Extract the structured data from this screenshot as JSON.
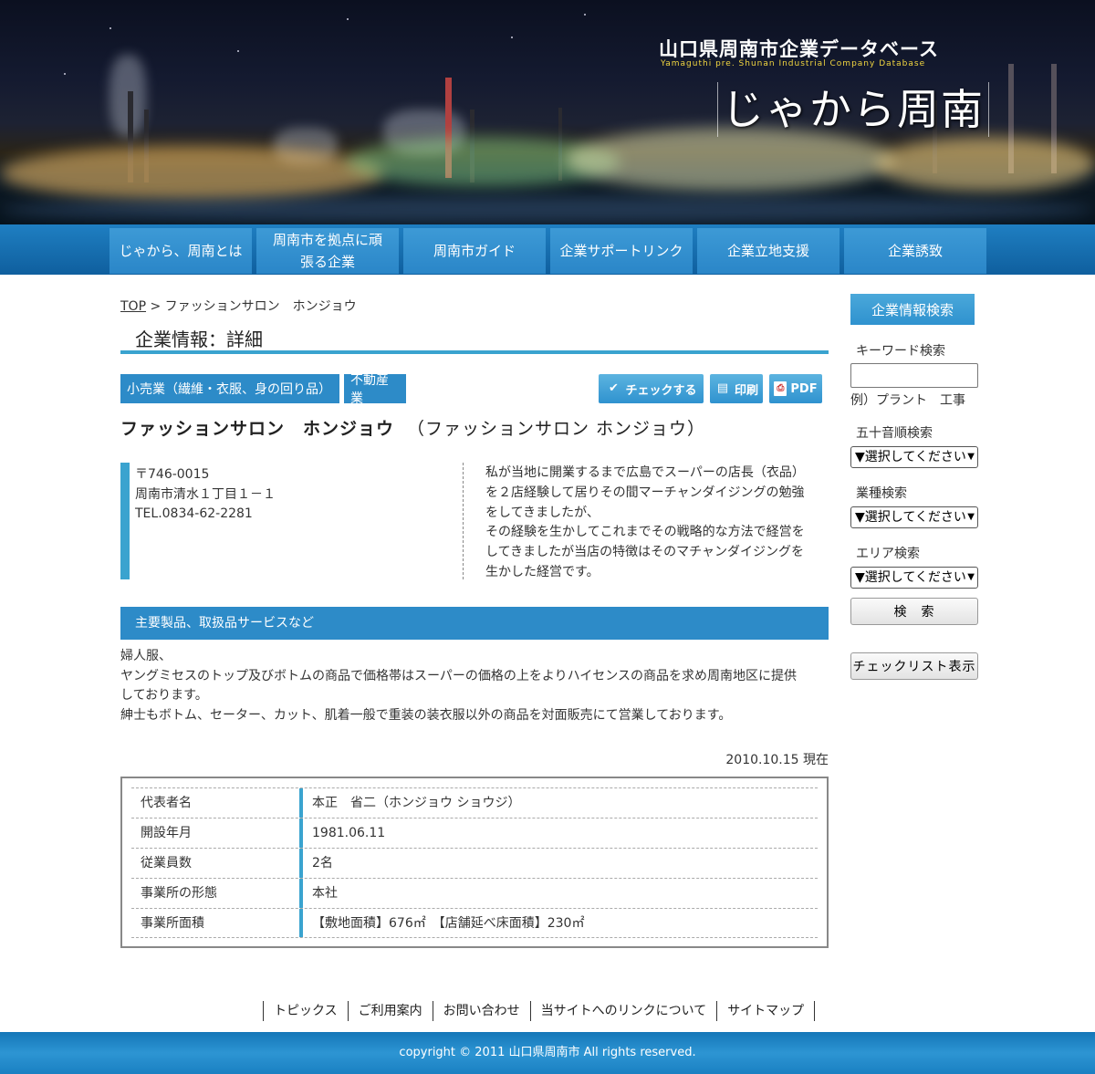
{
  "header": {
    "title": "山口県周南市企業データベース",
    "subtitle": "Yamaguthi pre. Shunan Industrial Company Database",
    "logo_text": "じゃから周南"
  },
  "nav": [
    {
      "label": "じゃから、周南とは"
    },
    {
      "label": "周南市を拠点に頑張る企業"
    },
    {
      "label": "周南市ガイド"
    },
    {
      "label": "企業サポートリンク"
    },
    {
      "label": "企業立地支援"
    },
    {
      "label": "企業誘致"
    }
  ],
  "breadcrumb": {
    "top": "TOP",
    "sep": " > ",
    "current": "ファッションサロン　ホンジョウ"
  },
  "page_heading": "企業情報：詳細",
  "categories": [
    "小売業（繊維・衣服、身の回り品）",
    "不動産業"
  ],
  "tools": {
    "check": "チェックする",
    "print": "印刷",
    "pdf": "PDF"
  },
  "company": {
    "name": "ファッションサロン　ホンジョウ",
    "kana": "（ファッションサロン ホンジョウ）",
    "postal": "〒746-0015",
    "address": "周南市清水１丁目１－１",
    "tel": "TEL.0834-62-2281",
    "intro": [
      "私が当地に開業するまで広島でスーパーの店長（衣品）",
      "を２店経験して居りその間マーチャンダイジングの勉強",
      "をしてきましたが、",
      "その経験を生かしてこれまでその戦略的な方法で経営を",
      "してきましたが当店の特徴はそのマチャンダイジングを",
      "生かした経営です。"
    ]
  },
  "products": {
    "heading": "主要製品、取扱品サービスなど",
    "lines": [
      "婦人服、",
      "ヤングミセスのトップ及びボトムの商品で価格帯はスーパーの価格の上をよりハイセンスの商品を求め周南地区に提供",
      "しております。",
      "紳士もボトム、セーター、カット、肌着一般で重装の装衣服以外の商品を対面販売にて営業しております。"
    ]
  },
  "as_of": "2010.10.15 現在",
  "details": [
    {
      "key": "代表者名",
      "value": "本正　省二（ホンジョウ ショウジ）"
    },
    {
      "key": "開設年月",
      "value": "1981.06.11"
    },
    {
      "key": "従業員数",
      "value": "2名"
    },
    {
      "key": "事業所の形態",
      "value": "本社"
    },
    {
      "key": "事業所面積",
      "value": "【敷地面積】676㎡　【店舗延べ床面積】230㎡"
    }
  ],
  "sidebar": {
    "title": "企業情報検索",
    "keyword_label": "キーワード検索",
    "keyword_value": "",
    "keyword_example": "例）プラント　工事",
    "kana_label": "五十音順検索",
    "kana_select": "▼選択してください",
    "industry_label": "業種検索",
    "industry_select": "▼選択してください",
    "area_label": "エリア検索",
    "area_select": "▼選択してください",
    "search_button": "検　索",
    "checklist_button": "チェックリスト表示"
  },
  "footer": {
    "links": [
      "トピックス",
      "ご利用案内",
      "お問い合わせ",
      "当サイトへのリンクについて",
      "サイトマップ"
    ],
    "copyright": "copyright © 2011 山口県周南市 All rights reserved."
  },
  "colors": {
    "nav_blue": "#2a86c8",
    "accent_blue": "#3aa3cf",
    "bar_blue": "#2d8bc8"
  }
}
